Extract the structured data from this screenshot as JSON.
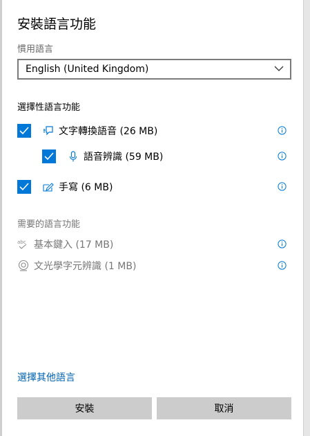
{
  "dialog": {
    "title": "安裝語言功能",
    "preferred_language_label": "慣用語言",
    "language_select": {
      "value": "English (United Kingdom)"
    }
  },
  "optional_features": {
    "heading": "選擇性語言功能",
    "items": [
      {
        "label": "文字轉換語音 (26 MB)",
        "checked": true,
        "icon": "text-to-speech-icon"
      },
      {
        "label": "語音辨識 (59 MB)",
        "checked": true,
        "icon": "microphone-icon"
      },
      {
        "label": "手寫 (6 MB)",
        "checked": true,
        "icon": "handwriting-icon"
      }
    ]
  },
  "required_features": {
    "heading": "需要的語言功能",
    "items": [
      {
        "label": "基本鍵入 (17 MB)",
        "icon": "spellcheck-icon"
      },
      {
        "label": "文光學字元辨識 (1 MB)",
        "icon": "ocr-icon"
      }
    ]
  },
  "more_languages_link": "選擇其他語言",
  "buttons": {
    "install": "安裝",
    "cancel": "取消"
  },
  "colors": {
    "accent": "#0078d7",
    "link": "#0063b1",
    "button_bg": "#cccccc"
  }
}
